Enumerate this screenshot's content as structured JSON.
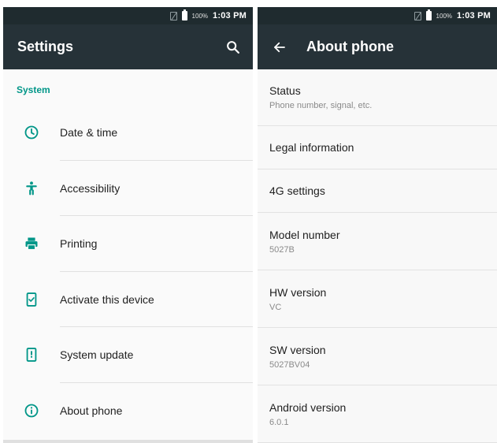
{
  "status_bar": {
    "battery_percent": "100%",
    "time": "1:03 PM"
  },
  "settings_screen": {
    "title": "Settings",
    "search_icon": "search-icon",
    "section_header": "System",
    "accent_color": "#009688",
    "items": [
      {
        "label": "Date & time",
        "icon": "clock-icon"
      },
      {
        "label": "Accessibility",
        "icon": "accessibility-icon"
      },
      {
        "label": "Printing",
        "icon": "printer-icon"
      },
      {
        "label": "Activate this device",
        "icon": "phone-check-icon"
      },
      {
        "label": "System update",
        "icon": "phone-update-icon"
      },
      {
        "label": "About phone",
        "icon": "info-icon"
      }
    ]
  },
  "about_screen": {
    "title": "About phone",
    "back_icon": "back-arrow-icon",
    "items": [
      {
        "primary": "Status",
        "secondary": "Phone number, signal, etc."
      },
      {
        "primary": "Legal information",
        "secondary": ""
      },
      {
        "primary": "4G settings",
        "secondary": ""
      },
      {
        "primary": "Model number",
        "secondary": "5027B"
      },
      {
        "primary": "HW version",
        "secondary": "VC"
      },
      {
        "primary": "SW version",
        "secondary": "5027BV04"
      },
      {
        "primary": "Android version",
        "secondary": "6.0.1"
      }
    ]
  },
  "colors": {
    "toolbar": "#263238",
    "status_bar": "#1f2b2f",
    "accent": "#009688"
  }
}
